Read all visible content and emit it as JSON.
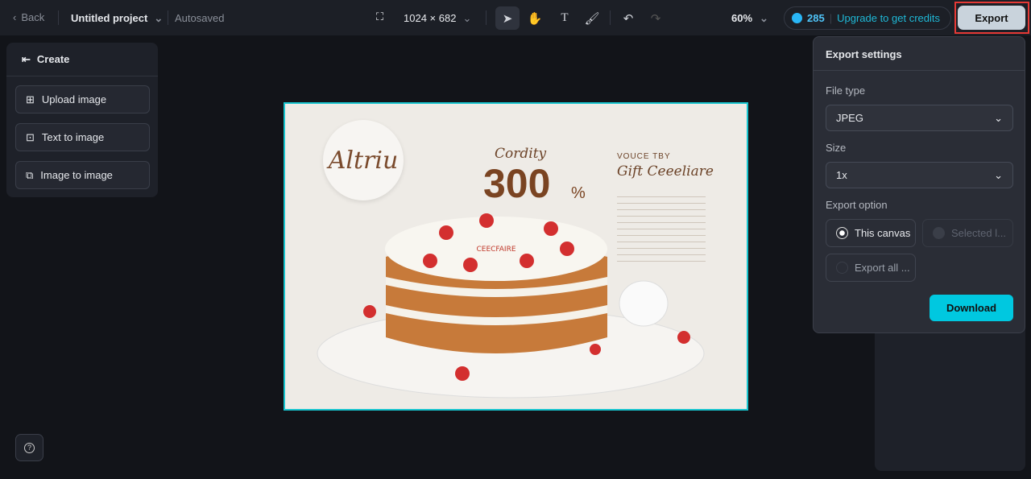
{
  "topbar": {
    "back": "Back",
    "project_name": "Untitled project",
    "save_status": "Autosaved",
    "canvas_size": "1024 × 682",
    "zoom": "60%",
    "credits": "285",
    "upgrade": "Upgrade to get credits",
    "export": "Export"
  },
  "create_panel": {
    "title": "Create",
    "items": [
      {
        "label": "Upload image",
        "icon": "upload-image-icon"
      },
      {
        "label": "Text to image",
        "icon": "text-to-image-icon"
      },
      {
        "label": "Image to image",
        "icon": "image-to-image-icon"
      }
    ]
  },
  "canvas_image": {
    "logo_text": "Altriu",
    "heading": "Cordity",
    "number": "300",
    "percent": "%",
    "right_top": "VOUCE TBY",
    "right_title": "Gift Ceeeliare",
    "cake_text": "CEECFAIRE"
  },
  "export_settings": {
    "title": "Export settings",
    "file_type_label": "File type",
    "file_type": "JPEG",
    "size_label": "Size",
    "size": "1x",
    "export_option_label": "Export option",
    "options": [
      {
        "label": "This canvas",
        "selected": true,
        "enabled": true
      },
      {
        "label": "Selected l...",
        "selected": false,
        "enabled": false
      },
      {
        "label": "Export all ...",
        "selected": false,
        "enabled": true
      }
    ],
    "download": "Download"
  },
  "colors": {
    "accent": "#00c8e0",
    "selection": "#18c5cf",
    "highlight": "#e53935"
  }
}
